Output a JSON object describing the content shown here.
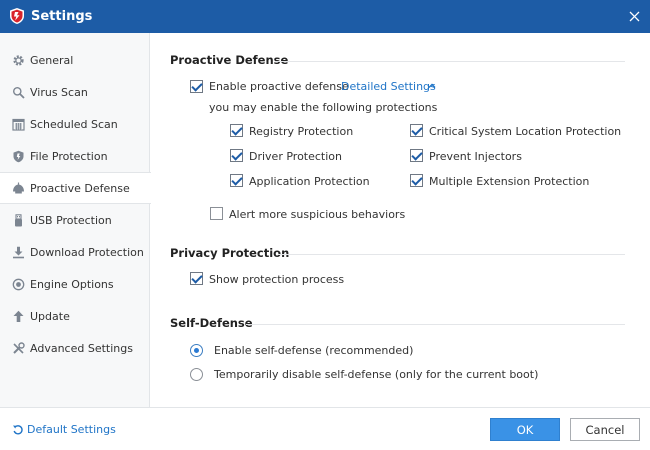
{
  "window": {
    "title": "Settings",
    "accent": "#1d5ca6"
  },
  "sidebar": {
    "items": [
      {
        "label": "General",
        "icon": "gear-icon",
        "active": false
      },
      {
        "label": "Virus Scan",
        "icon": "search-icon",
        "active": false
      },
      {
        "label": "Scheduled Scan",
        "icon": "calendar-icon",
        "active": false
      },
      {
        "label": "File Protection",
        "icon": "shield-icon",
        "active": false
      },
      {
        "label": "Proactive Defense",
        "icon": "proactive-icon",
        "active": true
      },
      {
        "label": "USB Protection",
        "icon": "usb-icon",
        "active": false
      },
      {
        "label": "Download Protection",
        "icon": "download-icon",
        "active": false
      },
      {
        "label": "Engine Options",
        "icon": "engine-icon",
        "active": false
      },
      {
        "label": "Update",
        "icon": "update-icon",
        "active": false
      },
      {
        "label": "Advanced Settings",
        "icon": "tools-icon",
        "active": false
      }
    ]
  },
  "proactive": {
    "title": "Proactive Defense",
    "enable_label": "Enable proactive defense",
    "enable_checked": true,
    "details_link": "Detailed Settings",
    "hint": "you may enable the following protections",
    "left_options": [
      {
        "label": "Registry Protection",
        "checked": true
      },
      {
        "label": "Driver Protection",
        "checked": true
      },
      {
        "label": "Application Protection",
        "checked": true
      }
    ],
    "right_options": [
      {
        "label": "Critical System Location Protection",
        "checked": true
      },
      {
        "label": "Prevent Injectors",
        "checked": true
      },
      {
        "label": "Multiple Extension Protection",
        "checked": true
      }
    ],
    "alert_label": "Alert more suspicious behaviors",
    "alert_checked": false
  },
  "privacy": {
    "title": "Privacy Protection",
    "show_label": "Show protection process",
    "show_checked": true
  },
  "selfdefense": {
    "title": "Self-Defense",
    "options": [
      {
        "label": "Enable self-defense (recommended)",
        "selected": true
      },
      {
        "label": "Temporarily disable self-defense (only for the current boot)",
        "selected": false
      }
    ]
  },
  "footer": {
    "default_link": "Default Settings",
    "ok_label": "OK",
    "cancel_label": "Cancel"
  }
}
